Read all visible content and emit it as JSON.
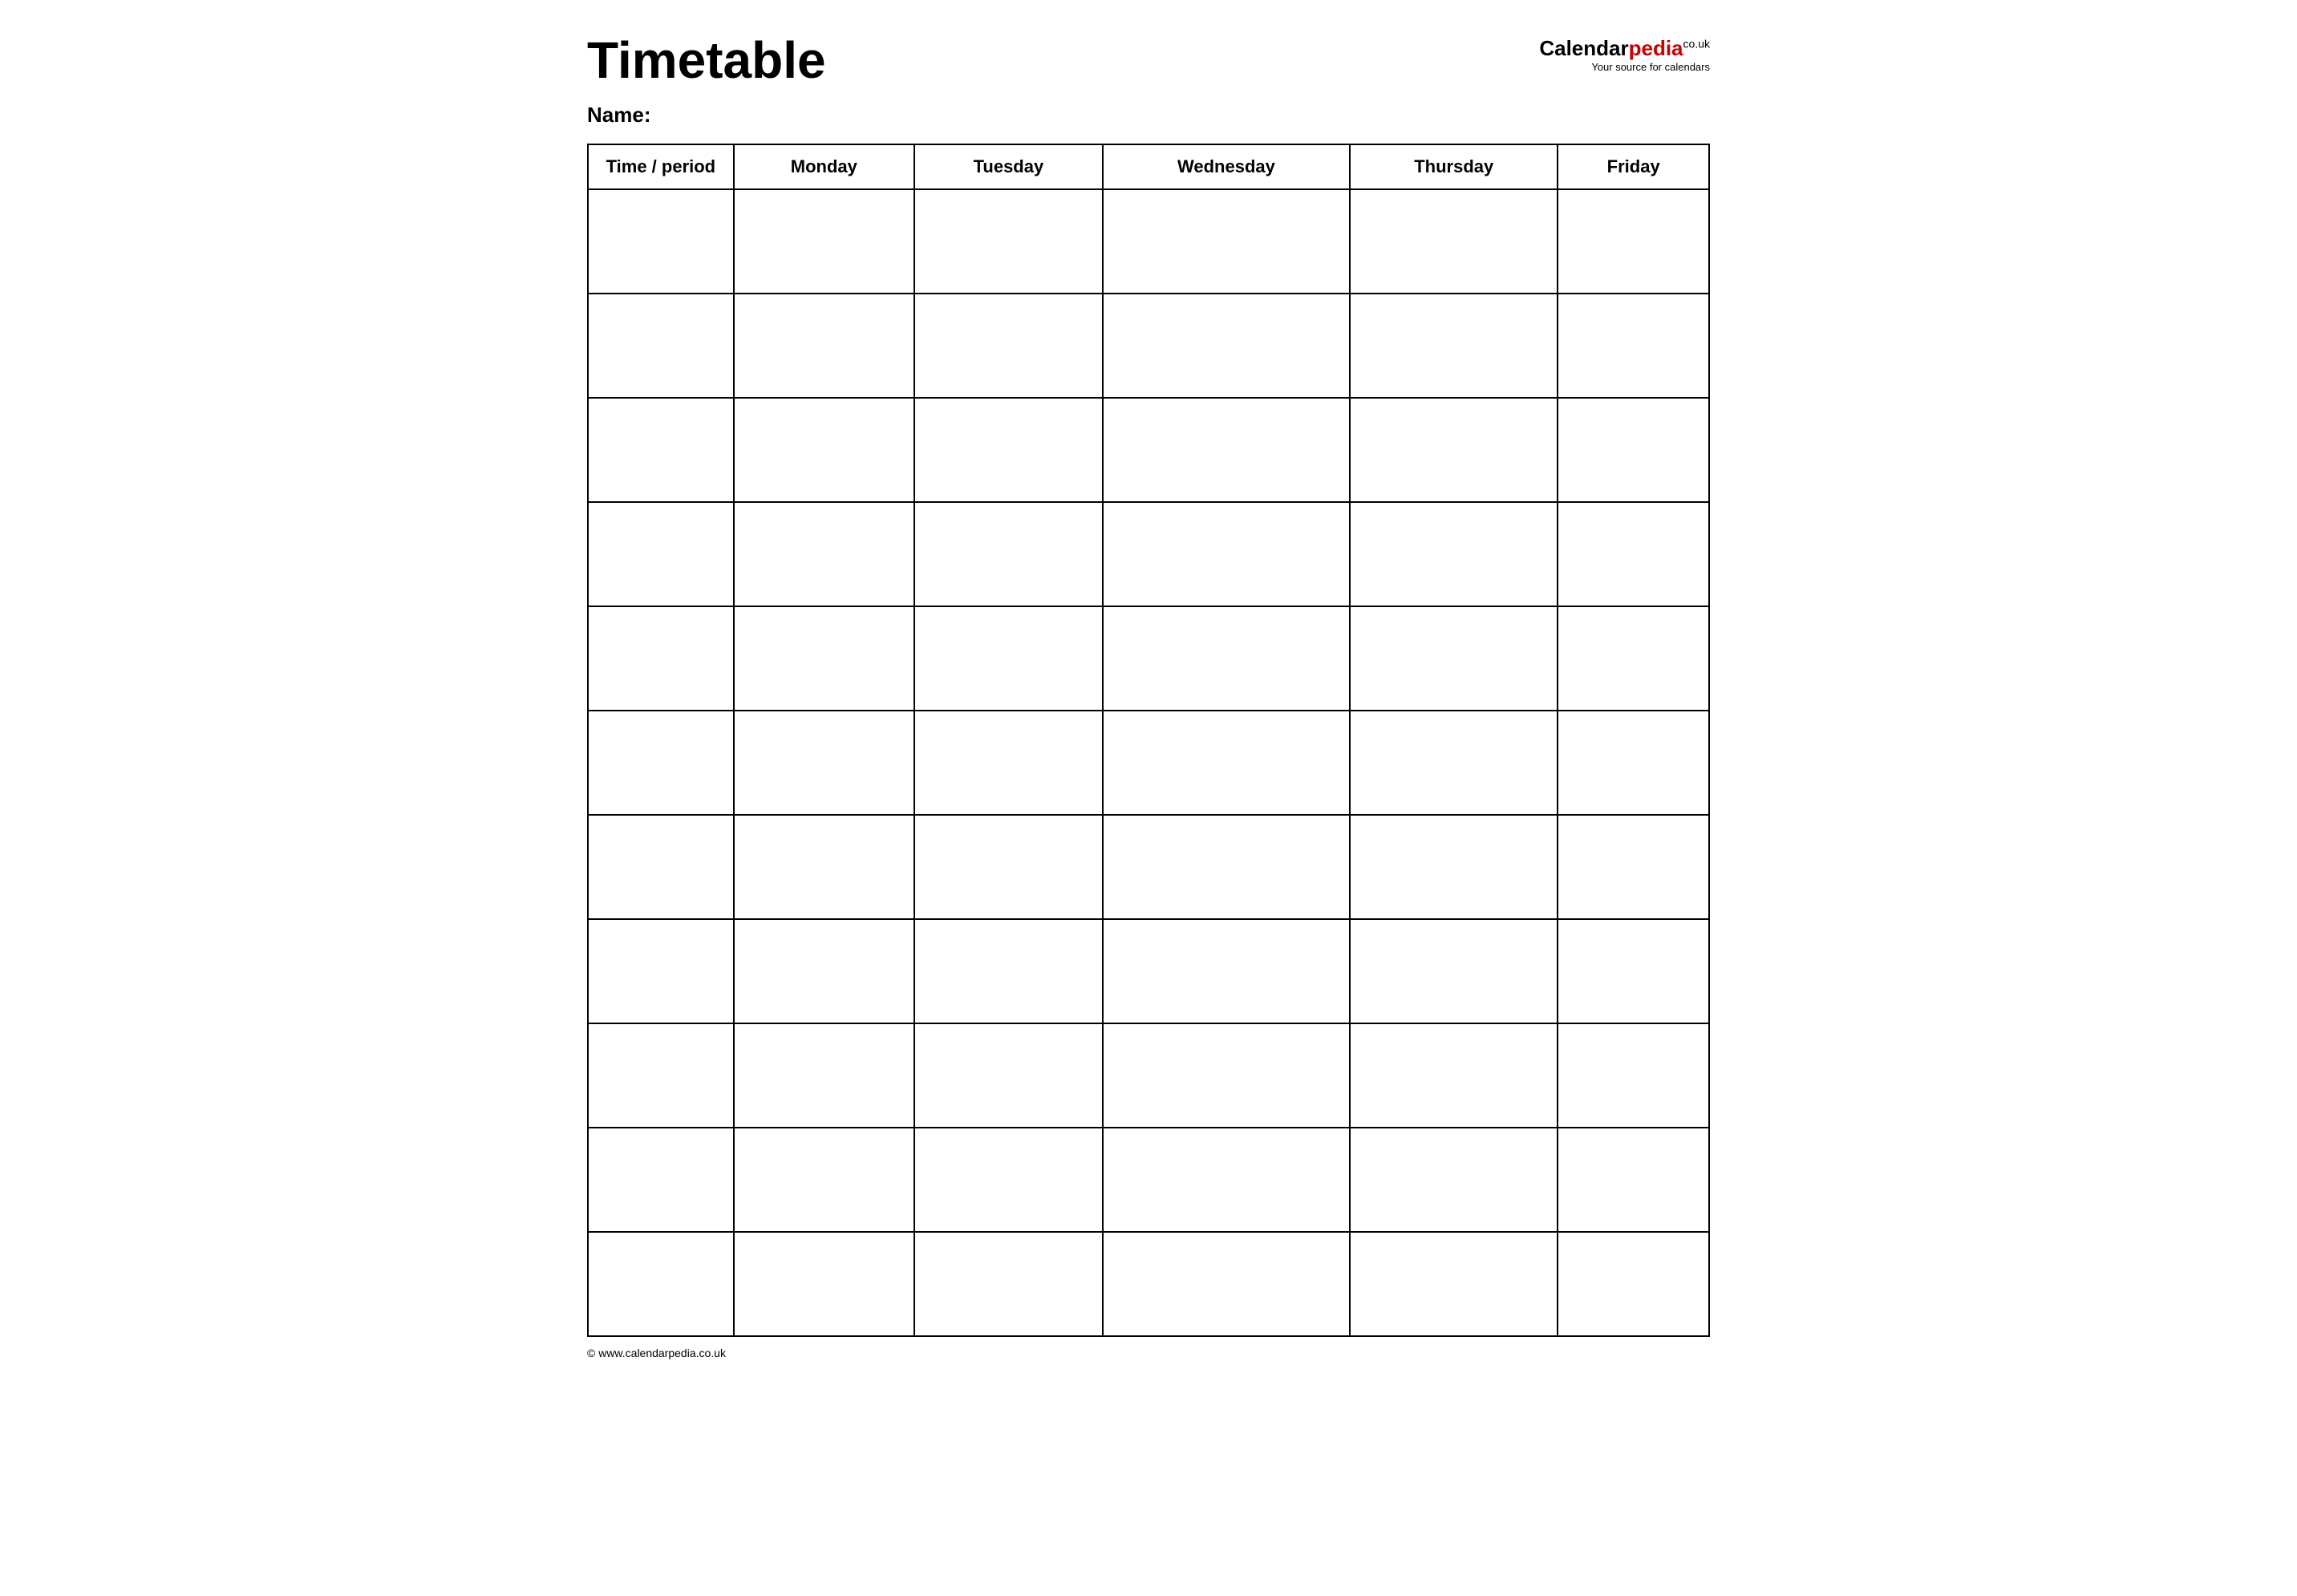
{
  "header": {
    "title": "Timetable",
    "name_label": "Name:",
    "logo": {
      "calendar_text": "Calendar",
      "pedia_text": "pedia",
      "couk_text": "co.uk",
      "tagline": "Your source for calendars"
    }
  },
  "table": {
    "columns": [
      {
        "id": "time",
        "label": "Time / period"
      },
      {
        "id": "monday",
        "label": "Monday"
      },
      {
        "id": "tuesday",
        "label": "Tuesday"
      },
      {
        "id": "wednesday",
        "label": "Wednesday"
      },
      {
        "id": "thursday",
        "label": "Thursday"
      },
      {
        "id": "friday",
        "label": "Friday"
      }
    ],
    "row_count": 11
  },
  "footer": {
    "url": "© www.calendarpedia.co.uk"
  }
}
